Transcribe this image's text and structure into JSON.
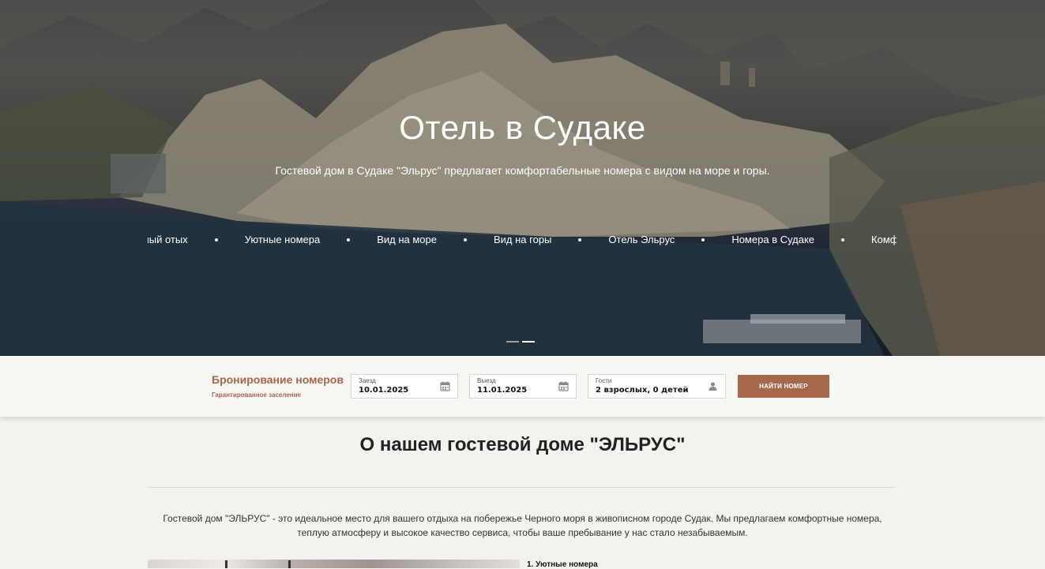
{
  "hero": {
    "title": "Отель в Судаке",
    "subtitle": "Гостевой дом в Судаке \"Эльрус\" предлагает комфортабельные номера с видом на море и горы.",
    "ticker": [
      "Комфортный отых",
      "Уютные номера",
      "Вид на море",
      "Вид на горы",
      "Отель Эльрус",
      "Номера в Судаке",
      "Комфортный отых"
    ],
    "slides": {
      "count": 2,
      "active_index": 1
    }
  },
  "booking": {
    "title": "Бронирование номеров",
    "subtitle": "Гарантированное заселение",
    "checkin": {
      "label": "Заезд",
      "value": "10.01.2025"
    },
    "checkout": {
      "label": "Выезд",
      "value": "11.01.2025"
    },
    "guests": {
      "label": "Гости",
      "value": "2 взрослых, 0 детей"
    },
    "find_button": "НАЙТИ НОМЕР"
  },
  "about": {
    "title": "О нашем гостевой доме \"ЭЛЬРУС\"",
    "text": "Гостевой дом \"ЭЛЬРУС\" - это идеальное место для вашего отдыха на побережье Черного моря в живописном городе Судак. Мы предлагаем комфортные номера, теплую атмосферу и высокое качество сервиса, чтобы ваше пребывание у нас стало незабываемым.",
    "first_item": "1. Уютные номера"
  },
  "colors": {
    "accent": "#a5684a",
    "bar_bg": "#f8f6f2",
    "page_bg": "#f3f2ef"
  },
  "icons": {
    "date": "calendar-icon",
    "guests": "person-icon"
  }
}
